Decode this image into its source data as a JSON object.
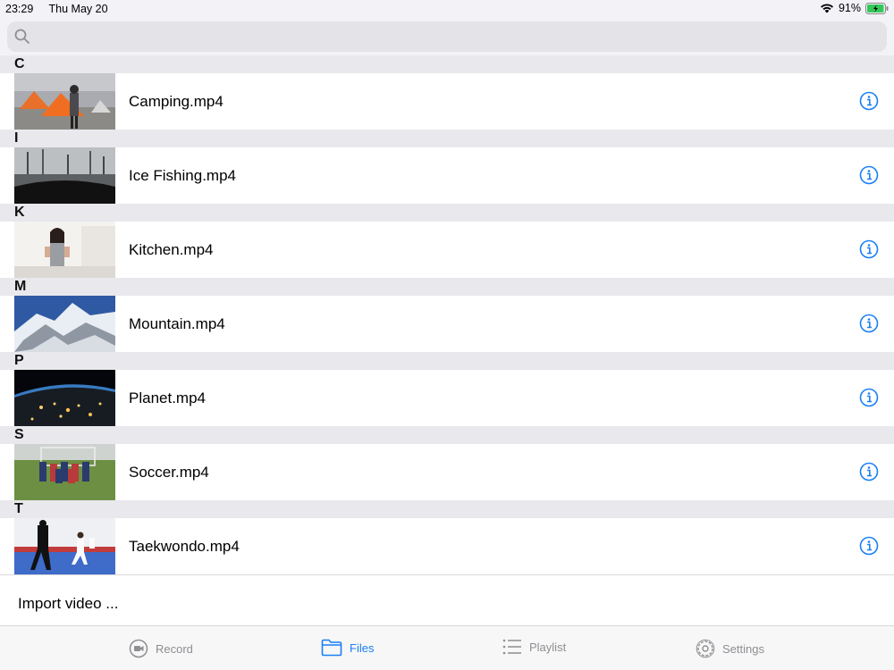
{
  "status": {
    "time": "23:29",
    "date": "Thu May 20",
    "battery": "91%"
  },
  "search": {
    "placeholder": ""
  },
  "sections": [
    {
      "letter": "C",
      "file": "Camping.mp4"
    },
    {
      "letter": "I",
      "file": "Ice Fishing.mp4"
    },
    {
      "letter": "K",
      "file": "Kitchen.mp4"
    },
    {
      "letter": "M",
      "file": "Mountain.mp4"
    },
    {
      "letter": "P",
      "file": "Planet.mp4"
    },
    {
      "letter": "S",
      "file": "Soccer.mp4"
    },
    {
      "letter": "T",
      "file": "Taekwondo.mp4"
    }
  ],
  "import": {
    "label": "Import video ..."
  },
  "tabs": [
    {
      "label": "Record",
      "icon": "record-icon",
      "active": false
    },
    {
      "label": "Files",
      "icon": "folder-icon",
      "active": true
    },
    {
      "label": "Playlist",
      "icon": "list-icon",
      "active": false
    },
    {
      "label": "Settings",
      "icon": "gear-icon",
      "active": false
    }
  ],
  "colors": {
    "accent": "#1a7ff5",
    "inactive": "#8e8e93",
    "section_bg": "#e8e8ed"
  }
}
